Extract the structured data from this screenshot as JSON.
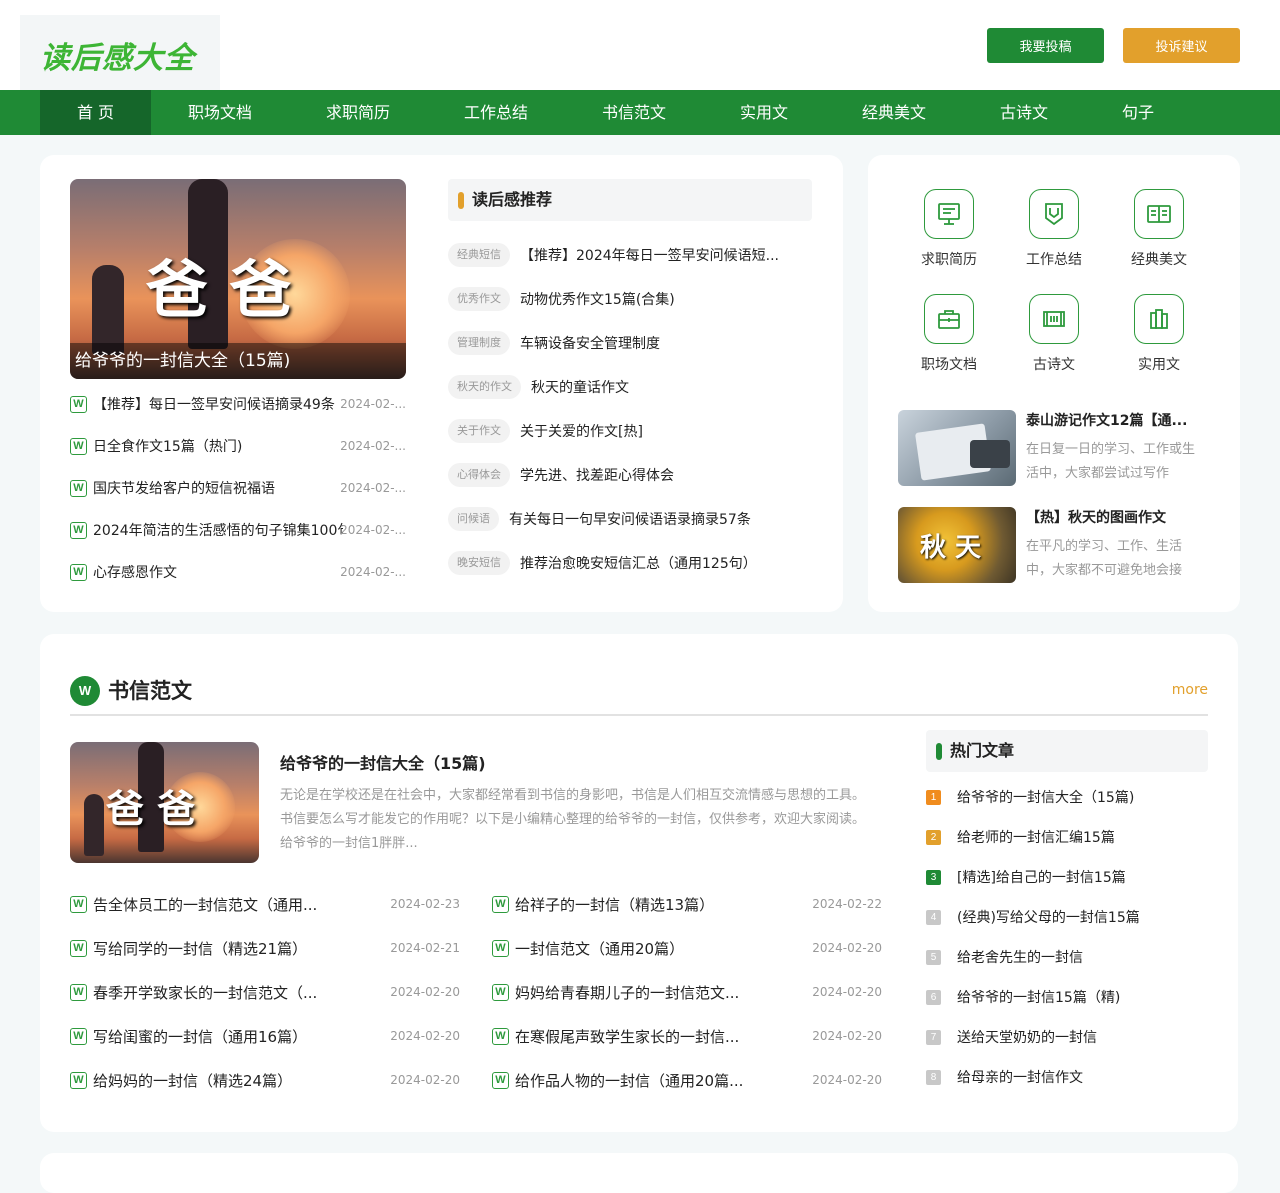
{
  "header": {
    "logo": "读后感大全",
    "submit_button": "我要投稿",
    "complain_button": "投诉建议",
    "colors": {
      "primary": "#1f8a35",
      "accent": "#e2a02c"
    }
  },
  "nav": [
    "首 页",
    "职场文档",
    "求职简历",
    "工作总结",
    "书信范文",
    "实用文",
    "经典美文",
    "古诗文",
    "句子"
  ],
  "hero": {
    "image_text": "爸 爸",
    "caption": "给爷爷的一封信大全（15篇)"
  },
  "left_list": [
    {
      "title": "【推荐】每日一签早安问候语摘录49条",
      "date": "2024-02-..."
    },
    {
      "title": "日全食作文15篇（热门)",
      "date": "2024-02-..."
    },
    {
      "title": "国庆节发给客户的短信祝福语",
      "date": "2024-02-..."
    },
    {
      "title": "2024年简洁的生活感悟的句子锦集100句",
      "date": "2024-02-..."
    },
    {
      "title": "心存感恩作文",
      "date": "2024-02-..."
    }
  ],
  "recommend": {
    "heading": "读后感推荐",
    "items": [
      {
        "tag": "经典短信",
        "title": "【推荐】2024年每日一签早安问候语短..."
      },
      {
        "tag": "优秀作文",
        "title": "动物优秀作文15篇(合集)"
      },
      {
        "tag": "管理制度",
        "title": "车辆设备安全管理制度"
      },
      {
        "tag": "秋天的作文",
        "title": "秋天的童话作文"
      },
      {
        "tag": "关于作文",
        "title": "关于关爱的作文[热]"
      },
      {
        "tag": "心得体会",
        "title": "学先进、找差距心得体会"
      },
      {
        "tag": "问候语",
        "title": "有关每日一句早安问候语语录摘录57条"
      },
      {
        "tag": "晚安短信",
        "title": "推荐治愈晚安短信汇总（通用125句）"
      }
    ]
  },
  "categories": [
    {
      "label": "求职简历",
      "icon": "presentation-board-icon"
    },
    {
      "label": "工作总结",
      "icon": "bookmark-shield-icon"
    },
    {
      "label": "经典美文",
      "icon": "open-book-icon"
    },
    {
      "label": "职场文档",
      "icon": "briefcase-icon"
    },
    {
      "label": "古诗文",
      "icon": "scroll-icon"
    },
    {
      "label": "实用文",
      "icon": "books-icon"
    }
  ],
  "side_articles": [
    {
      "title": "泰山游记作文12篇【通...",
      "desc": "在日复一日的学习、工作或生活中，大家都尝试过写作"
    },
    {
      "title": "【热】秋天的图画作文",
      "desc": "在平凡的学习、工作、生活中，大家都不可避免地会接",
      "image_text": "秋 天"
    }
  ],
  "section": {
    "title": "书信范文",
    "badge": "W",
    "more": "more",
    "featured": {
      "image_text": "爸 爸",
      "title": "给爷爷的一封信大全（15篇)",
      "desc": "无论是在学校还是在社会中，大家都经常看到书信的身影吧，书信是人们相互交流情感与思想的工具。书信要怎么写才能发它的作用呢？以下是小编精心整理的给爷爷的一封信，仅供参考，欢迎大家阅读。给爷爷的一封信1胖胖..."
    },
    "list_left": [
      {
        "title": "告全体员工的一封信范文（通用...",
        "date": "2024-02-23"
      },
      {
        "title": "写给同学的一封信（精选21篇）",
        "date": "2024-02-21"
      },
      {
        "title": "春季开学致家长的一封信范文（...",
        "date": "2024-02-20"
      },
      {
        "title": "写给闺蜜的一封信（通用16篇）",
        "date": "2024-02-20"
      },
      {
        "title": "给妈妈的一封信（精选24篇）",
        "date": "2024-02-20"
      }
    ],
    "list_right": [
      {
        "title": "给祥子的一封信（精选13篇）",
        "date": "2024-02-22"
      },
      {
        "title": "一封信范文（通用20篇）",
        "date": "2024-02-20"
      },
      {
        "title": "妈妈给青春期儿子的一封信范文...",
        "date": "2024-02-20"
      },
      {
        "title": "在寒假尾声致学生家长的一封信...",
        "date": "2024-02-20"
      },
      {
        "title": "给作品人物的一封信（通用20篇...",
        "date": "2024-02-20"
      }
    ],
    "hot": {
      "heading": "热门文章",
      "items": [
        {
          "num": "1",
          "title": "给爷爷的一封信大全（15篇)",
          "color": "#f08c1e"
        },
        {
          "num": "2",
          "title": "给老师的一封信汇编15篇",
          "color": "#e2a02c"
        },
        {
          "num": "3",
          "title": "[精选]给自己的一封信15篇",
          "color": "#1f8a35"
        },
        {
          "num": "4",
          "title": "(经典)写给父母的一封信15篇",
          "color": "#c8c8c8"
        },
        {
          "num": "5",
          "title": "给老舍先生的一封信",
          "color": "#c8c8c8"
        },
        {
          "num": "6",
          "title": "给爷爷的一封信15篇（精)",
          "color": "#c8c8c8"
        },
        {
          "num": "7",
          "title": "送给天堂奶奶的一封信",
          "color": "#c8c8c8"
        },
        {
          "num": "8",
          "title": "给母亲的一封信作文",
          "color": "#c8c8c8"
        }
      ]
    }
  }
}
